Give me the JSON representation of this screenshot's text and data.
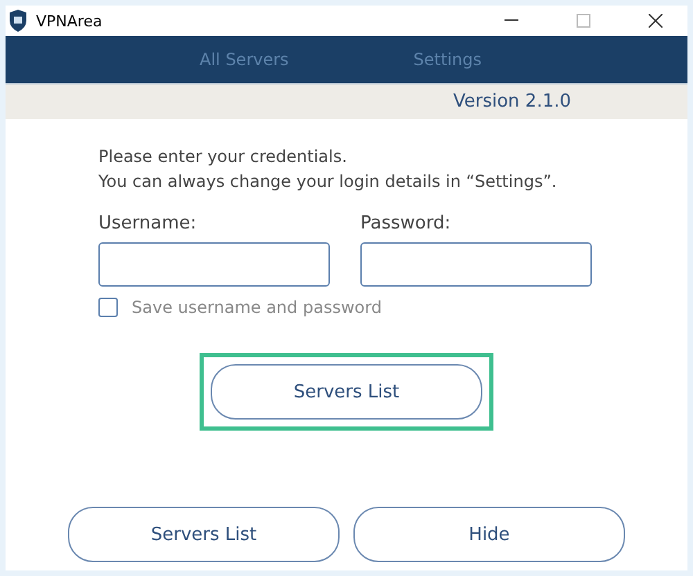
{
  "window": {
    "title": "VPNArea"
  },
  "nav": [
    {
      "label": "All Servers",
      "selected": false
    },
    {
      "label": "Settings",
      "selected": false
    }
  ],
  "version": "Version  2.1.0",
  "intro": [
    "Please enter your credentials.",
    "You can always change your login details in “Settings”."
  ],
  "username": {
    "label": "Username:"
  },
  "password": {
    "label": "Password:"
  },
  "save": {
    "label": "Save username and password",
    "checked": false
  },
  "main_button": {
    "label": "Servers List",
    "highlighted": true
  },
  "buttons": [
    "Servers List",
    "Hide"
  ]
}
